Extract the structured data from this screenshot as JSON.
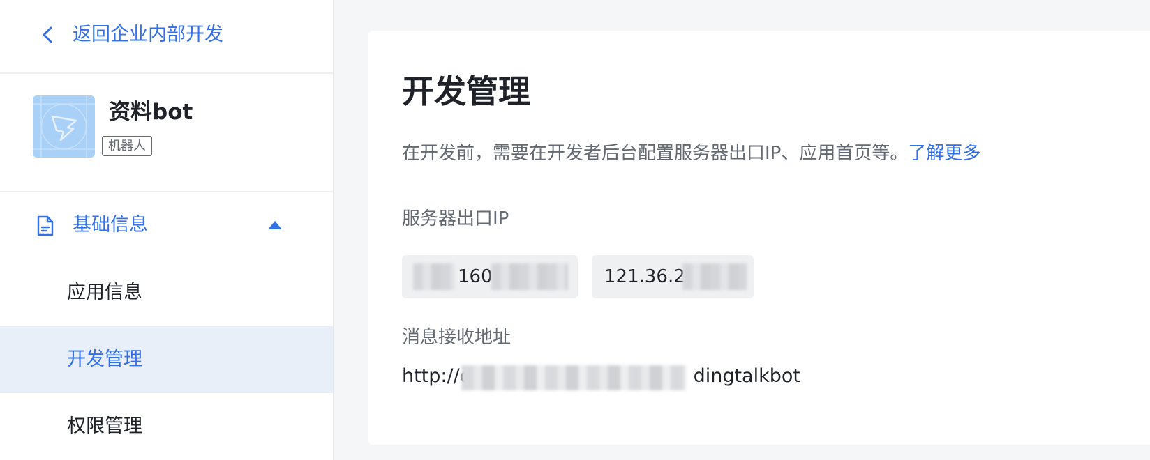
{
  "sidebar": {
    "back_label": "返回企业内部开发",
    "app": {
      "name": "资料bot",
      "badge": "机器人"
    },
    "group": {
      "label": "基础信息",
      "expanded": true
    },
    "items": [
      {
        "label": "应用信息",
        "active": false
      },
      {
        "label": "开发管理",
        "active": true
      },
      {
        "label": "权限管理",
        "active": false
      }
    ]
  },
  "main": {
    "title": "开发管理",
    "intro_text": "在开发前，需要在开发者后台配置服务器出口IP、应用首页等。",
    "learn_more": "了解更多",
    "server_ip_label": "服务器出口IP",
    "server_ips": [
      "160",
      "121.36.2"
    ],
    "message_url_label": "消息接收地址",
    "message_url_prefix": "http://c",
    "message_url_suffix": "dingtalkbot"
  },
  "colors": {
    "accent": "#3370e6",
    "active_bg": "#e9eff9",
    "logo_bg": "#a9d0f7",
    "page_bg": "#f5f6f8"
  },
  "icons": [
    "chevron-left-icon",
    "app-logo-icon",
    "document-icon",
    "caret-up-icon"
  ]
}
